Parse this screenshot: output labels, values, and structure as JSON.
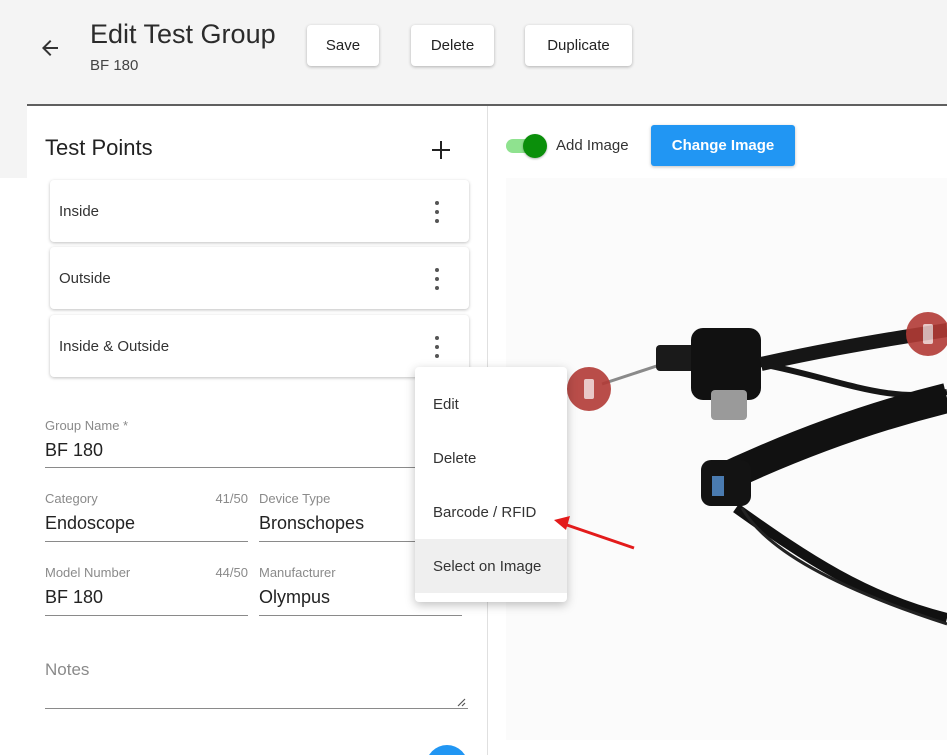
{
  "header": {
    "title": "Edit Test Group",
    "subtitle": "BF 180",
    "buttons": {
      "save": "Save",
      "delete": "Delete",
      "duplicate": "Duplicate"
    }
  },
  "test_points": {
    "title": "Test Points",
    "items": [
      {
        "label": "Inside"
      },
      {
        "label": "Outside"
      },
      {
        "label": "Inside & Outside"
      }
    ]
  },
  "form": {
    "group_name": {
      "label": "Group Name *",
      "value": "BF 180"
    },
    "category": {
      "label": "Category",
      "value": "Endoscope",
      "counter": "41/50"
    },
    "device_type": {
      "label": "Device Type",
      "value": "Bronschopes"
    },
    "model_number": {
      "label": "Model Number",
      "value": "BF 180",
      "counter": "44/50"
    },
    "manufacturer": {
      "label": "Manufacturer",
      "value": "Olympus"
    },
    "notes": {
      "label": "Notes"
    }
  },
  "image_panel": {
    "toggle_label": "Add Image",
    "toggle_on": true,
    "change_button": "Change Image"
  },
  "context_menu": {
    "items": [
      "Edit",
      "Delete",
      "Barcode / RFID",
      "Select on Image"
    ],
    "highlighted": "Select on Image"
  },
  "colors": {
    "accent": "#2196f3",
    "toggle_thumb": "#0b8f0b",
    "toggle_track": "#8fe28f",
    "marker": "#b23b36",
    "annotation_arrow": "#e31b1b"
  },
  "icons": [
    "back-arrow-icon",
    "plus-icon",
    "kebab-menu-icon",
    "resize-handle-icon"
  ]
}
